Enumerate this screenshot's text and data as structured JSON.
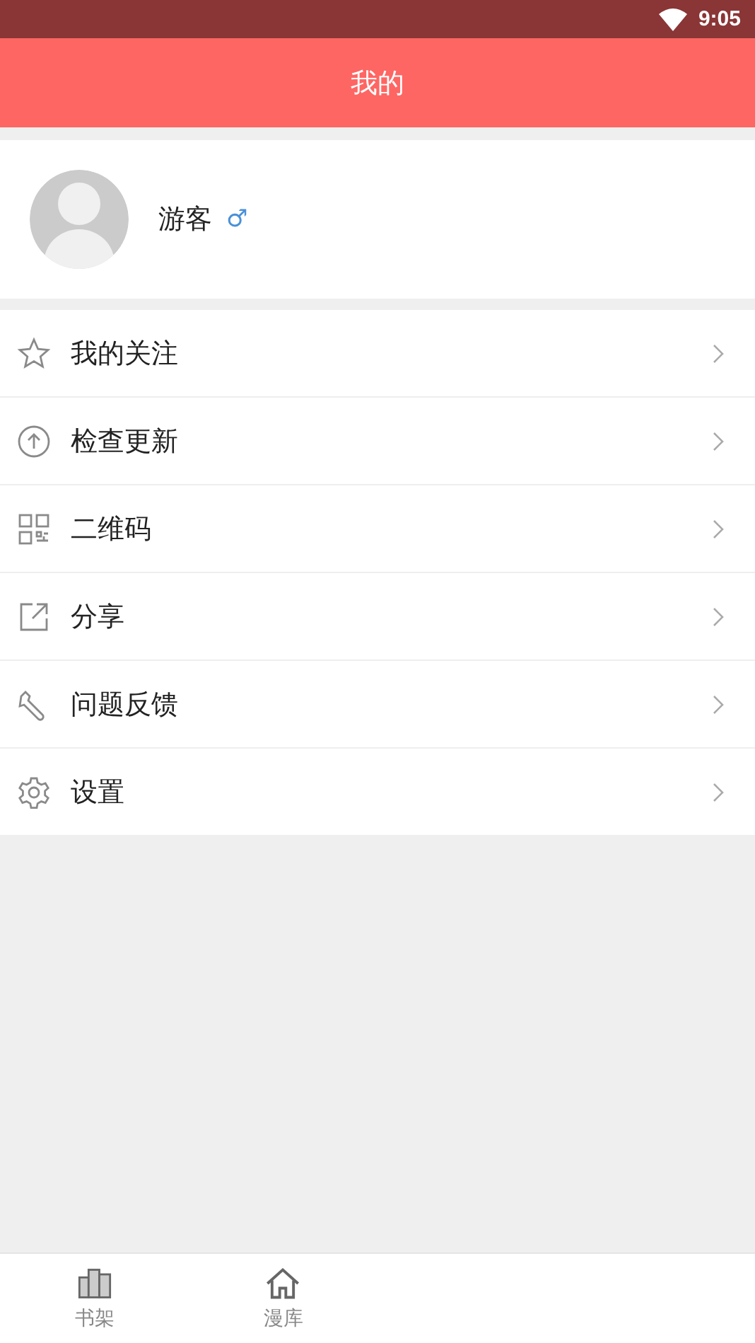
{
  "status_bar": {
    "time": "9:05"
  },
  "header": {
    "title": "我的"
  },
  "profile": {
    "name": "游客",
    "gender": "♂"
  },
  "menu": [
    {
      "kind": "star",
      "label": "我的关注"
    },
    {
      "kind": "upload",
      "label": "检查更新"
    },
    {
      "kind": "qrcode",
      "label": "二维码"
    },
    {
      "kind": "share",
      "label": "分享"
    },
    {
      "kind": "wrench",
      "label": "问题反馈"
    },
    {
      "kind": "gear",
      "label": "设置"
    }
  ],
  "tab_bar": [
    {
      "kind": "shelf",
      "label": "书架",
      "selected": false
    },
    {
      "kind": "home",
      "label": "漫库",
      "selected": false
    }
  ]
}
